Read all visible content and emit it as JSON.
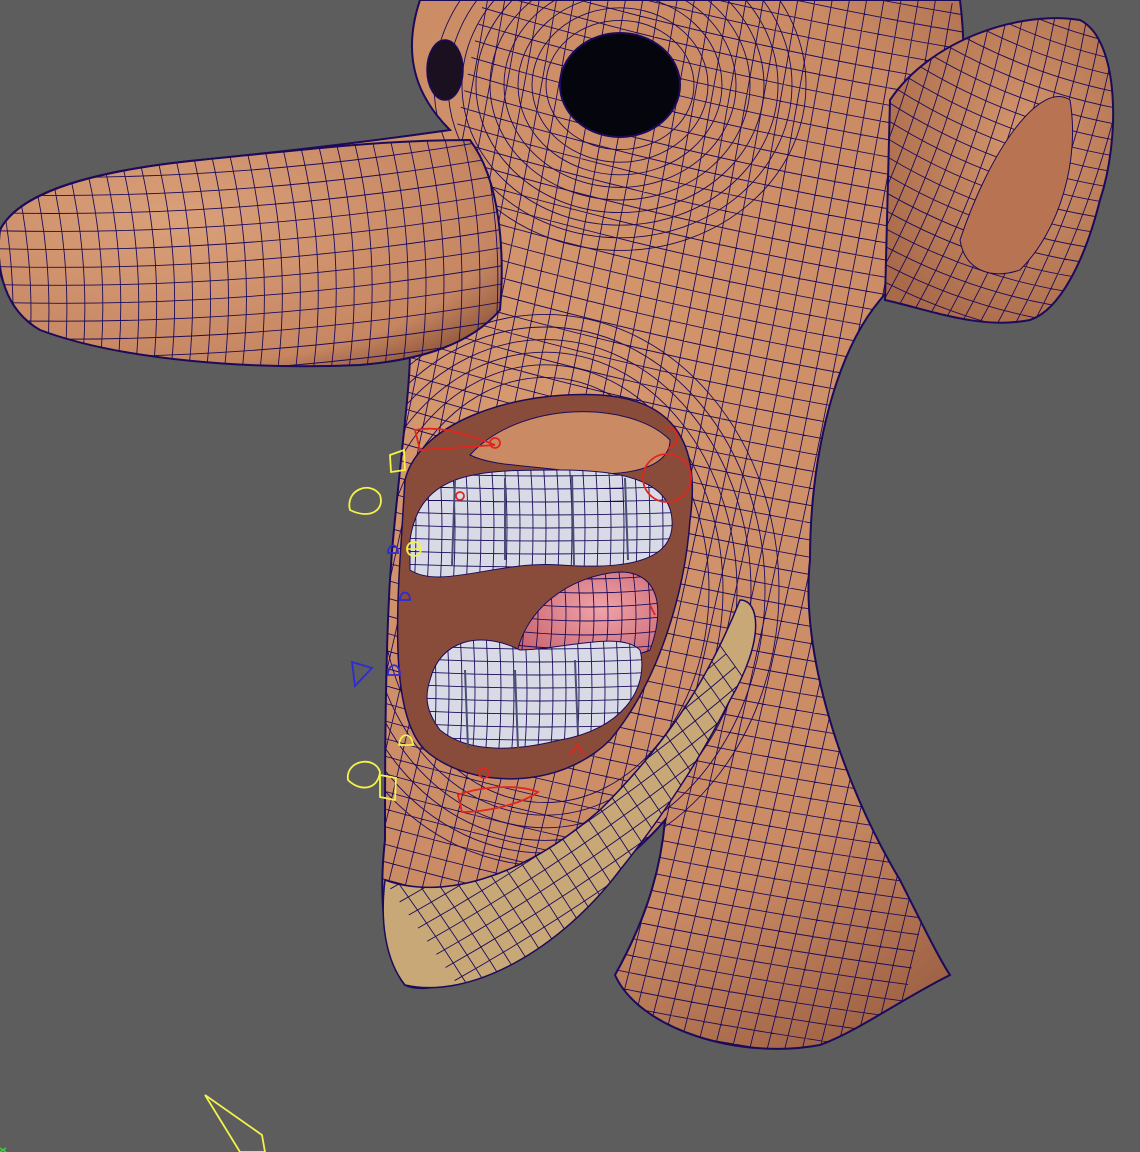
{
  "viewport": {
    "background": "#5d5d5d",
    "description_visible_text": ""
  },
  "model": {
    "skin_color": "#c98a64",
    "skin_shadow": "#a9694a",
    "wireframe_color": "#1c0b5a",
    "chin_strap_color": "#c9a877",
    "teeth_color": "#d8dbe6",
    "tongue_color": "#d9828b",
    "mouth_interior": "#8c4f3e"
  },
  "controls": {
    "yellow": "#f2f24a",
    "red": "#e0261f",
    "blue": "#2b2bd8",
    "green": "#39d439"
  }
}
